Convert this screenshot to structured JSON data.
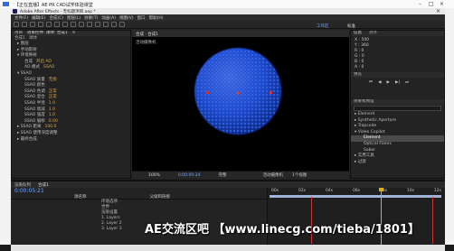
{
  "window": {
    "title": "【正在直播】AE PR C4D试学体验课堂"
  },
  "app": {
    "title": "Adobe After Effects - 无标题项目.aep *"
  },
  "menu": [
    "文件(F)",
    "编辑(E)",
    "合成(C)",
    "图层(L)",
    "效果(T)",
    "动画(A)",
    "视图(V)",
    "窗口",
    "帮助(H)"
  ],
  "workspace": "工作区",
  "workspace_mode": "标准",
  "left_panel": {
    "tabs": [
      "项目",
      "效果控件: 球体: 合成1",
      "≡"
    ],
    "layer_title": "合成1 · 球体",
    "rows": [
      {
        "label": "▸ 图层",
        "val": ""
      },
      {
        "label": "▸ 手动影射",
        "val": ""
      },
      {
        "label": "▾ 环境映射",
        "val": ""
      },
      {
        "label": "合成",
        "val": "开启 AO"
      },
      {
        "label": "AO 模式",
        "val": "SSAO"
      },
      {
        "label": "▾ SSAO",
        "val": ""
      },
      {
        "label": "SSAO 质量",
        "val": "无损"
      },
      {
        "label": "SSAO 颜色",
        "val": ""
      },
      {
        "label": "SSAO 色调",
        "val": "正常"
      },
      {
        "label": "SSAO 混合",
        "val": "正常"
      },
      {
        "label": "SSAO 半径",
        "val": "1.0"
      },
      {
        "label": "SSAO 衰减",
        "val": "1.0"
      },
      {
        "label": "SSAO 强度",
        "val": "1.0"
      },
      {
        "label": "SSAO 偏移",
        "val": "0.00"
      },
      {
        "label": "▸ SSAO 距离",
        "val": "100.0"
      },
      {
        "label": "▸ SSAO 使用深度调整",
        "val": ""
      },
      {
        "label": "▸ 最终合成",
        "val": ""
      }
    ]
  },
  "comp": {
    "tab": "合成 · 合成1",
    "label": "活动摄像机",
    "zoom": "100%",
    "timecode": "0:00:00:24",
    "quality": "完整",
    "camera": "活动摄像机",
    "views": "1个视图"
  },
  "right_panel": {
    "title": "信息",
    "align_title": "对齐",
    "info": [
      "X : 500",
      "Y : 360",
      "R : 0",
      "G : 0",
      "B : 0",
      "A : 0"
    ],
    "preview_title": "预览",
    "effects_title": "效果和预设",
    "effects": [
      "▸ Element",
      "▸ Synthetic Aperture",
      "▸ Trapcode",
      "▾ Video Copilot",
      "Element",
      "Optical Flares",
      "Saber",
      "▸ 实用工具",
      "▸ 过渡"
    ],
    "selected_effect": "Element"
  },
  "timeline": {
    "tabs": [
      "渲染队列",
      "合成1"
    ],
    "timecode": "0:00:05:21",
    "headers": [
      "源名称",
      "父级和链接"
    ],
    "layers": [
      "环境选项",
      "世界",
      "渲染设置",
      "1. Layers",
      "2. Layer 2",
      "3. Layer 3"
    ],
    "ruler": [
      "00s",
      "02s",
      "04s",
      "06s",
      "08s",
      "10s",
      "12s"
    ]
  },
  "watermark": "AE交流区吧 【www.linecg.com/tieba/1801】",
  "colors": {
    "accent": "#4f7bd8",
    "sphere": "#1f4fd6",
    "playhead": "#e5b000"
  }
}
